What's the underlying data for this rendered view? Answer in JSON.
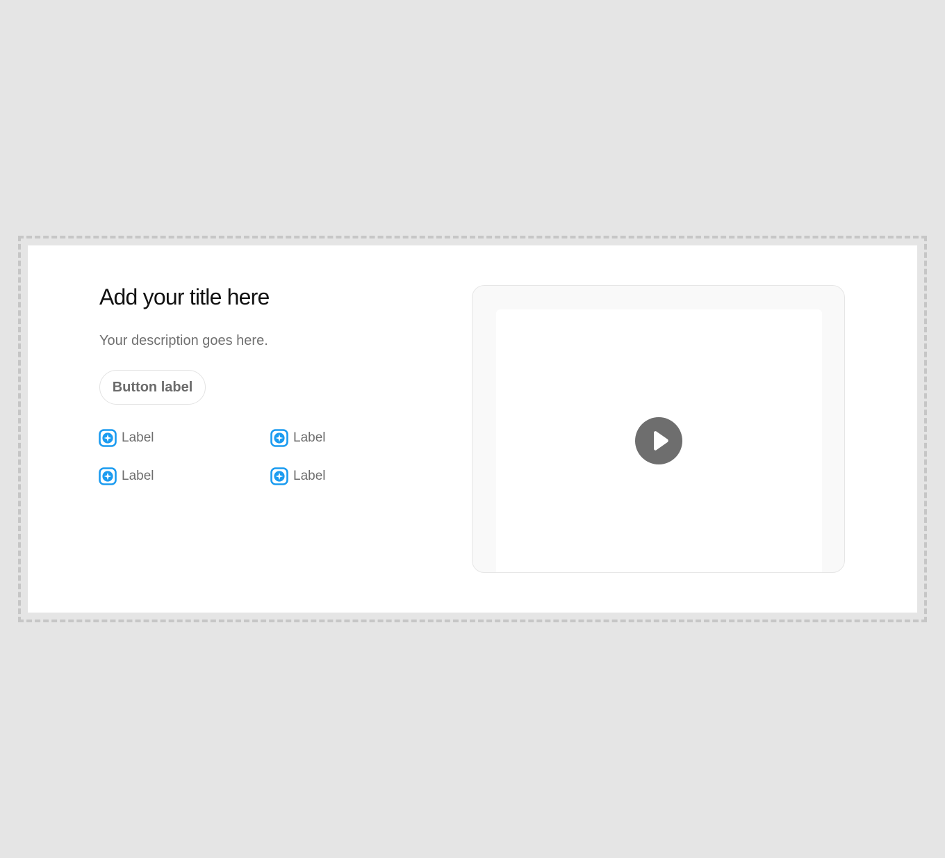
{
  "hero": {
    "title": "Add your title here",
    "description": "Your description goes here.",
    "button_label": "Button label"
  },
  "features": [
    {
      "label": "Label",
      "icon": "sparkle-icon"
    },
    {
      "label": "Label",
      "icon": "sparkle-icon"
    },
    {
      "label": "Label",
      "icon": "sparkle-icon"
    },
    {
      "label": "Label",
      "icon": "sparkle-icon"
    }
  ],
  "media": {
    "icon": "play-icon"
  },
  "colors": {
    "accent": "#1a9bf0",
    "background": "#e5e5e5",
    "section": "#ffffff",
    "play": "#6e6e6e"
  }
}
